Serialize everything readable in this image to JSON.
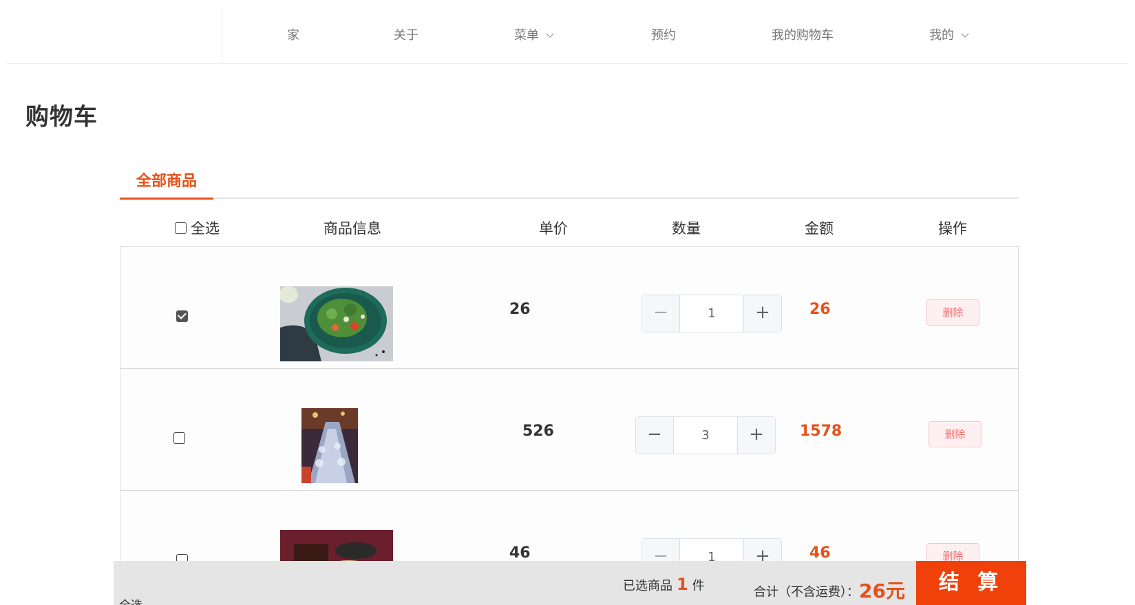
{
  "nav": {
    "home": "家",
    "about": "关于",
    "menu": "菜单",
    "reserve": "预约",
    "cart": "我的购物车",
    "mine": "我的"
  },
  "page": {
    "title": "购物车"
  },
  "tabs": {
    "all_items": "全部商品"
  },
  "table_headers": {
    "select_all": "全选",
    "info": "商品信息",
    "unit_price": "单价",
    "quantity": "数量",
    "amount": "金额",
    "action": "操作"
  },
  "items": [
    {
      "checked": true,
      "price": "26",
      "quantity": "1",
      "amount": "26",
      "delete": "删除",
      "image": "salad-photo"
    },
    {
      "checked": false,
      "price": "526",
      "quantity": "3",
      "amount": "1578",
      "delete": "删除",
      "image": "banquet-table-photo"
    },
    {
      "checked": false,
      "price": "46",
      "quantity": "1",
      "amount": "46",
      "delete": "删除",
      "image": "dessert-photo"
    }
  ],
  "footer": {
    "select_all": "全选",
    "selected_prefix": "已选商品",
    "selected_count": "1",
    "selected_suffix": "件",
    "total_label": "合计（不含运费）：",
    "total_value": "26元",
    "checkout": "结 算"
  },
  "colors": {
    "accent": "#e8501a",
    "checkout": "#f0410a",
    "delete_bg": "#fef0f0",
    "delete_text": "#f56c6c"
  }
}
